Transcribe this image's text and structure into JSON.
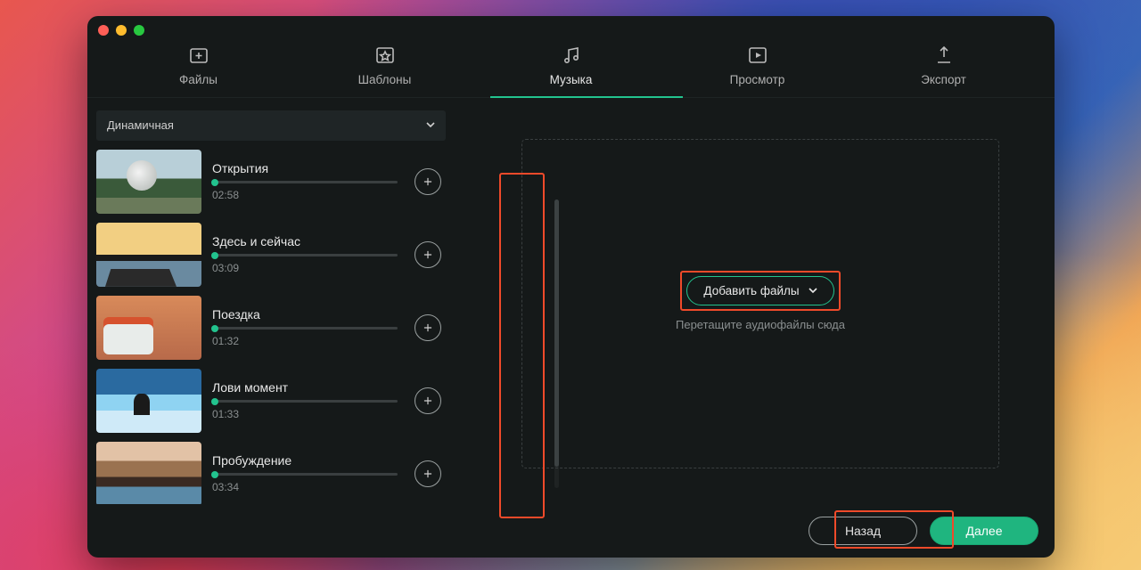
{
  "tabs": {
    "files": "Файлы",
    "templates": "Шаблоны",
    "music": "Музыка",
    "preview": "Просмотр",
    "export": "Экспорт",
    "active": "music"
  },
  "category_dropdown": {
    "selected": "Динамичная"
  },
  "tracks": [
    {
      "title": "Открытия",
      "duration": "02:58"
    },
    {
      "title": "Здесь и сейчас",
      "duration": "03:09"
    },
    {
      "title": "Поездка",
      "duration": "01:32"
    },
    {
      "title": "Лови момент",
      "duration": "01:33"
    },
    {
      "title": "Пробуждение",
      "duration": "03:34"
    }
  ],
  "dropzone": {
    "add_button": "Добавить файлы",
    "hint": "Перетащите аудиофайлы сюда"
  },
  "footer": {
    "back": "Назад",
    "next": "Далее"
  },
  "highlights": {
    "add_column": true,
    "add_files_button": true,
    "next_button": true
  },
  "colors": {
    "accent": "#22c38e",
    "highlight": "#ef4a2a"
  }
}
